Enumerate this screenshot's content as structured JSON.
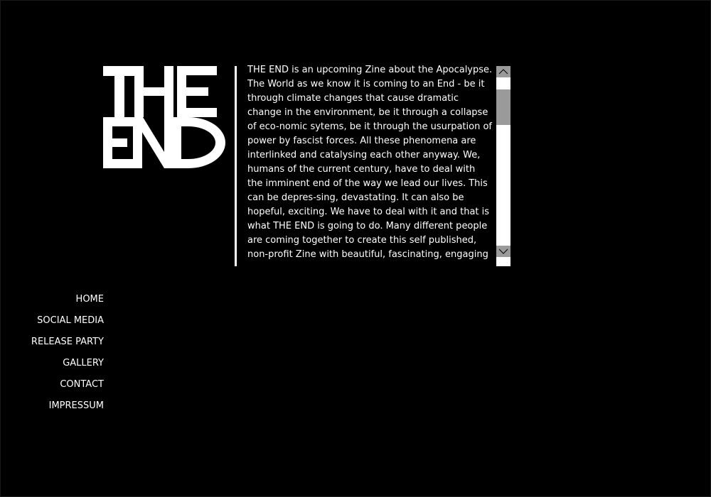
{
  "logo": {
    "line1": "THE",
    "line2": "END"
  },
  "intro": {
    "text": "THE END is an upcoming Zine about the Apocalypse. The World as we know it is coming to an End - be it through climate changes that cause dramatic change in the environment, be it through a collapse of eco-nomic sytems, be it through the usurpation of power by fascist forces. All these phenomena are interlinked and catalysing each other anyway. We, humans of the current century, have to deal with the imminent end of the way we lead our lives. This can be depres-sing, devastating. It can also be hopeful, exciting. We have to deal with it and that is what THE END is going to do. Many different people are coming together to create this self published, non-profit Zine with beautiful, fascinating, engaging content of all"
  },
  "nav": {
    "items": [
      {
        "label": "HOME"
      },
      {
        "label": "SOCIAL MEDIA"
      },
      {
        "label": "RELEASE PARTY"
      },
      {
        "label": "GALLERY"
      },
      {
        "label": "CONTACT"
      },
      {
        "label": "IMPRESSUM"
      }
    ]
  },
  "colors": {
    "background": "#000000",
    "text": "#ffffff",
    "scrollbar": "#9a9a9a"
  },
  "icons": {
    "scroll_up": "chevron-up-icon",
    "scroll_down": "chevron-down-icon"
  }
}
